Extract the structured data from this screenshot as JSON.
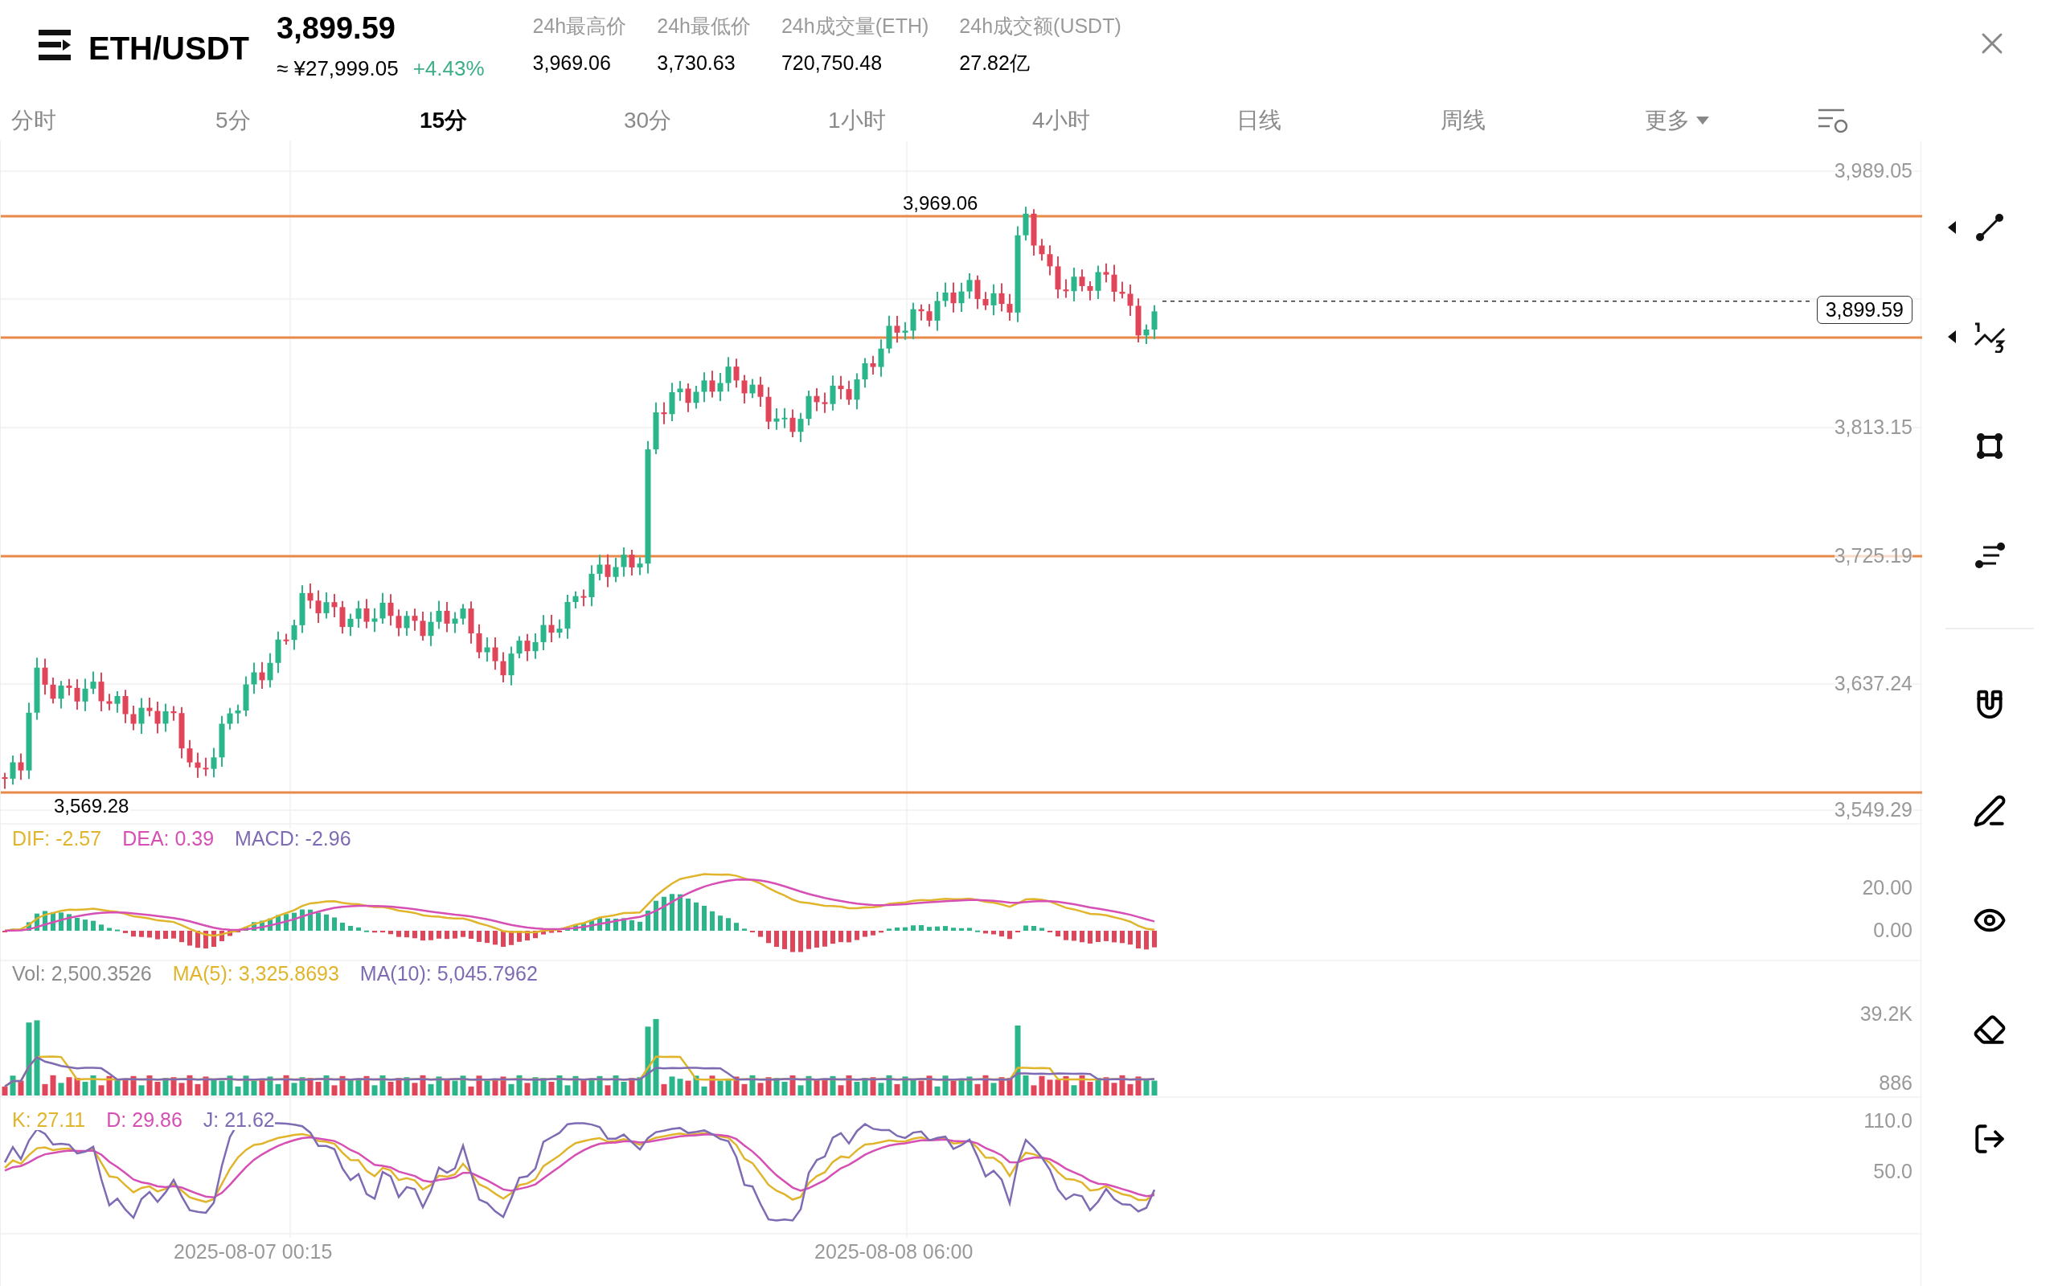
{
  "header": {
    "title": "ETH/USDT",
    "price": "3,899.59",
    "cny": "≈ ¥27,999.05",
    "change": "+4.43%",
    "change_up": true
  },
  "stats": [
    {
      "label": "24h最高价",
      "value": "3,969.06"
    },
    {
      "label": "24h最低价",
      "value": "3,730.63"
    },
    {
      "label": "24h成交量(ETH)",
      "value": "720,750.48"
    },
    {
      "label": "24h成交额(USDT)",
      "value": "27.82亿"
    }
  ],
  "tabs": [
    {
      "label": "分时",
      "selected": false,
      "kind": "plain"
    },
    {
      "label": "5分",
      "selected": false,
      "kind": "plain"
    },
    {
      "label": "15分",
      "selected": true,
      "kind": "plain"
    },
    {
      "label": "30分",
      "selected": false,
      "kind": "plain"
    },
    {
      "label": "1小时",
      "selected": false,
      "kind": "plain"
    },
    {
      "label": "4小时",
      "selected": false,
      "kind": "plain"
    },
    {
      "label": "日线",
      "selected": false,
      "kind": "plain"
    },
    {
      "label": "周线",
      "selected": false,
      "kind": "plain"
    },
    {
      "label": "更多",
      "selected": false,
      "kind": "dropdown"
    }
  ],
  "price_axis": [
    "3,989.05",
    "3,813.15",
    "3,725.19",
    "3,637.24",
    "3,549.29"
  ],
  "high_label": "3,969.06",
  "low_label": "3,569.28",
  "current_price": "3,899.59",
  "macd": {
    "legend": [
      {
        "text": "DIF: -2.57",
        "color": "#e0b52c"
      },
      {
        "text": "DEA: 0.39",
        "color": "#d64fb5"
      },
      {
        "text": "MACD: -2.96",
        "color": "#7e6bb3"
      }
    ],
    "ticks": [
      "20.00",
      "0.00"
    ]
  },
  "volume": {
    "legend": [
      {
        "text": "Vol: 2,500.3526",
        "color": "#8c8c8c"
      },
      {
        "text": "MA(5): 3,325.8693",
        "color": "#e0b52c"
      },
      {
        "text": "MA(10): 5,045.7962",
        "color": "#7e6bb3"
      }
    ],
    "ticks": [
      "39.2K",
      "886"
    ]
  },
  "kdj": {
    "legend": [
      {
        "text": "K: 27.11",
        "color": "#e0b52c"
      },
      {
        "text": "D: 29.86",
        "color": "#d64fb5"
      },
      {
        "text": "J: 21.62",
        "color": "#7e6bb3"
      }
    ],
    "ticks": [
      "110.0",
      "50.0"
    ]
  },
  "time_labels": [
    "2025-08-07 00:15",
    "2025-08-08 06:00"
  ],
  "tools": [
    {
      "kind": "segment",
      "submenu": true
    },
    {
      "kind": "fib",
      "submenu": true
    },
    {
      "kind": "rect",
      "submenu": false
    },
    {
      "kind": "lines",
      "submenu": false
    },
    {
      "kind": "divider"
    },
    {
      "kind": "magnet",
      "submenu": false
    },
    {
      "kind": "pencil",
      "submenu": false
    },
    {
      "kind": "eye",
      "submenu": false
    },
    {
      "kind": "eraser",
      "submenu": false
    },
    {
      "kind": "exit",
      "submenu": false
    }
  ]
}
